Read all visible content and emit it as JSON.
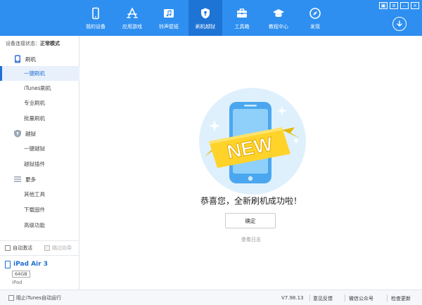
{
  "window": {
    "controls": {
      "skin": "▣",
      "menu": "≡",
      "minimize": "–",
      "close": "×"
    },
    "download_icon": "download-circle-icon"
  },
  "nav": [
    {
      "label": "我的设备",
      "icon": "phone-icon",
      "active": false
    },
    {
      "label": "应用游戏",
      "icon": "app-store-icon",
      "active": false
    },
    {
      "label": "铃声壁纸",
      "icon": "music-image-icon",
      "active": false
    },
    {
      "label": "刷机越狱",
      "icon": "shield-key-icon",
      "active": true
    },
    {
      "label": "工具箱",
      "icon": "toolbox-icon",
      "active": false
    },
    {
      "label": "教程中心",
      "icon": "graduation-cap-icon",
      "active": false
    },
    {
      "label": "发现",
      "icon": "compass-icon",
      "active": false
    }
  ],
  "sidebar": {
    "connection_label": "设备连接状态：",
    "connection_value": "正常模式",
    "sections": [
      {
        "title": "刷机",
        "icon": "phone-flash-icon",
        "items": [
          {
            "label": "一键刷机",
            "active": true
          },
          {
            "label": "iTunes刷机",
            "active": false
          },
          {
            "label": "专业刷机",
            "active": false
          },
          {
            "label": "批量刷机",
            "active": false
          }
        ]
      },
      {
        "title": "越狱",
        "icon": "jailbreak-shield-icon",
        "items": [
          {
            "label": "一键越狱",
            "active": false
          },
          {
            "label": "越狱插件",
            "active": false
          }
        ]
      },
      {
        "title": "更多",
        "icon": "list-more-icon",
        "items": [
          {
            "label": "其他工具",
            "active": false
          },
          {
            "label": "下载固件",
            "active": false
          },
          {
            "label": "高级功能",
            "active": false
          }
        ]
      }
    ],
    "auto_activate": "自动激活",
    "skip_guide": "跳过向导",
    "device": {
      "name": "iPad Air 3",
      "capacity": "64GB",
      "type": "iPad"
    }
  },
  "main": {
    "badge_text": "NEW",
    "success_message": "恭喜您，全新刷机成功啦！",
    "confirm_button": "确定",
    "view_log_link": "查看日志",
    "colors": {
      "circle": "#dff0fd",
      "ribbon": "#ffd32a",
      "phone": "#59b4f4",
      "accent": "#2e8ff0"
    }
  },
  "footer": {
    "block_itunes": "阻止iTunes自动运行",
    "version": "V7.98.13",
    "feedback": "意见反馈",
    "wechat": "微信公众号",
    "check_update": "检查更新"
  }
}
